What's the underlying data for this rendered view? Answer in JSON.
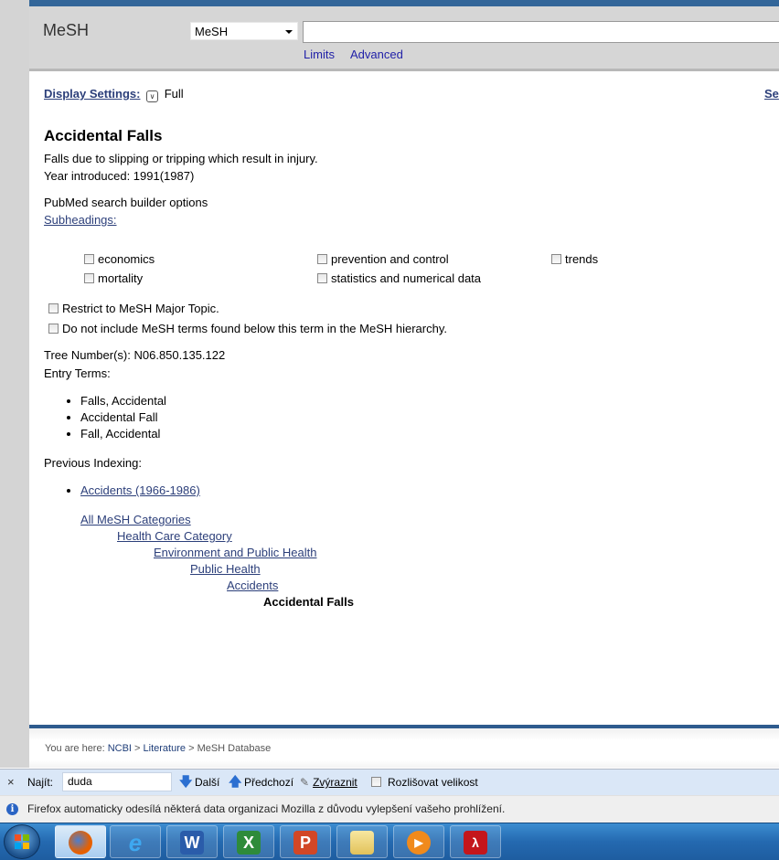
{
  "search": {
    "db_title": "MeSH",
    "db_select_value": "MeSH",
    "query": "",
    "limits": "Limits",
    "advanced": "Advanced"
  },
  "display": {
    "settings_label": "Display Settings:",
    "format": "Full",
    "send_to": "Se"
  },
  "record": {
    "title": "Accidental Falls",
    "scope_note": "Falls due to slipping or tripping which result in injury.",
    "year_introduced": "Year introduced: 1991(1987)",
    "builder_label": "PubMed search builder options",
    "subheadings_label": "Subheadings:",
    "subheadings": [
      {
        "label": "economics",
        "checked": false
      },
      {
        "label": "mortality",
        "checked": false
      },
      {
        "label": "prevention and control",
        "checked": false
      },
      {
        "label": "statistics and numerical data",
        "checked": false
      },
      {
        "label": "trends",
        "checked": false
      }
    ],
    "restrict_major": "Restrict to MeSH Major Topic.",
    "no_explode": "Do not include MeSH terms found below this term in the MeSH hierarchy.",
    "tree_number": "Tree Number(s): N06.850.135.122",
    "entry_terms_label": "Entry Terms:",
    "entry_terms": [
      "Falls, Accidental",
      "Accidental Fall",
      "Fall, Accidental"
    ],
    "previous_indexing_label": "Previous Indexing:",
    "previous_indexing": [
      "Accidents (1966-1986)"
    ],
    "tree": [
      {
        "label": "All MeSH Categories",
        "link": true
      },
      {
        "label": "Health Care Category",
        "link": true
      },
      {
        "label": "Environment and Public Health",
        "link": true
      },
      {
        "label": "Public Health",
        "link": true
      },
      {
        "label": "Accidents",
        "link": true
      },
      {
        "label": "Accidental Falls",
        "link": false
      }
    ]
  },
  "footer": {
    "prefix": "You are here: ",
    "crumbs": [
      "NCBI",
      "Literature",
      "MeSH Database"
    ],
    "sep": " > "
  },
  "findbar": {
    "close": "×",
    "label": "Najít:",
    "value": "duda",
    "next": "Další",
    "prev": "Předchozí",
    "highlight": "Zvýraznit",
    "match_case": "Rozlišovat velikost"
  },
  "infobar": {
    "message": "Firefox automaticky odesílá některá data organizaci Mozilla z důvodu vylepšení vašeho prohlížení."
  },
  "taskbar": {
    "apps": [
      "Firefox",
      "Internet Explorer",
      "Word",
      "Excel",
      "PowerPoint",
      "Windows Explorer",
      "Media Player",
      "Adobe Reader"
    ],
    "active": "Firefox"
  }
}
